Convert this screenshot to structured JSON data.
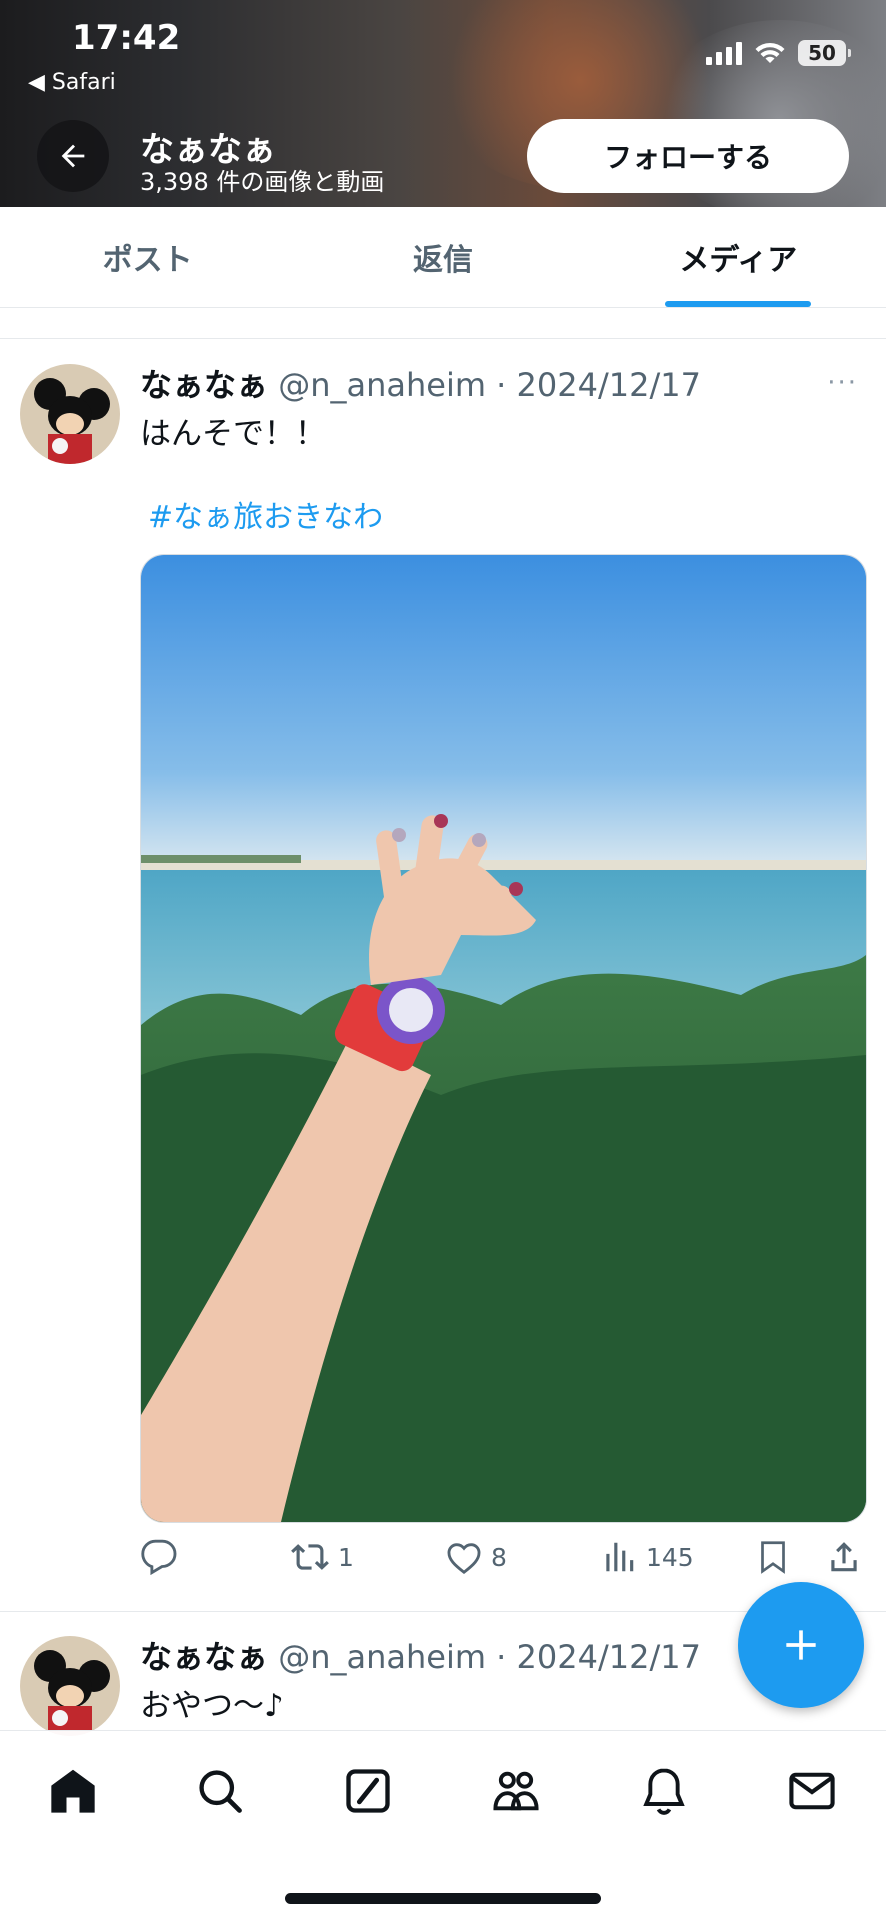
{
  "status_bar": {
    "time": "17:42",
    "back_app": "◀ Safari",
    "battery": "50"
  },
  "header": {
    "name": "なぁなぁ",
    "subtitle": "3,398 件の画像と動画",
    "follow_label": "フォローする"
  },
  "tabs": [
    {
      "label": "ポスト",
      "active": false
    },
    {
      "label": "返信",
      "active": false
    },
    {
      "label": "メディア",
      "active": true
    }
  ],
  "posts": [
    {
      "display_name": "なぁなぁ",
      "meta": "@n_anaheim · 2024/12/17",
      "text": "はんそで！！",
      "hashtag": "#なぁ旅おきなわ",
      "more": "···",
      "stats": {
        "retweets": "1",
        "likes": "8",
        "views": "145"
      }
    },
    {
      "display_name": "なぁなぁ",
      "meta": "@n_anaheim · 2024/12/17",
      "text": "おやつ〜♪"
    }
  ],
  "colors": {
    "accent": "#1d9bf0",
    "text": "#0f1419",
    "secondary": "#536471"
  },
  "icons": {
    "nav": [
      "home-icon",
      "search-icon",
      "grok-icon",
      "communities-icon",
      "notifications-icon",
      "messages-icon"
    ],
    "actions": [
      "reply-icon",
      "retweet-icon",
      "like-icon",
      "views-icon",
      "bookmark-icon",
      "share-icon"
    ]
  }
}
